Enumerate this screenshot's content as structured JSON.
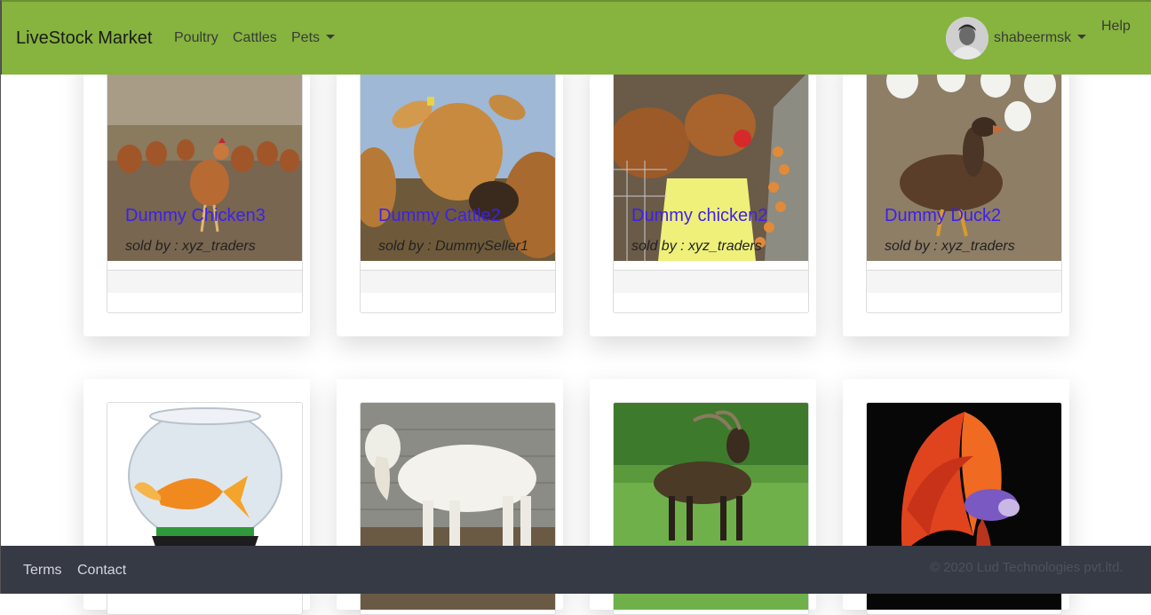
{
  "navbar": {
    "brand": "LiveStock Market",
    "links": [
      "Poultry",
      "Cattles",
      "Pets"
    ],
    "username": "shabeermsk",
    "help": "Help",
    "accent_color": "#86b43e"
  },
  "listings": [
    {
      "title": "Dummy Chicken3",
      "seller": "sold by : xyz_traders",
      "image": "chickens-in-yard"
    },
    {
      "title": "Dummy Cattle2",
      "seller": "sold by : DummySeller1",
      "image": "brown-cow"
    },
    {
      "title": "Dummy chicken2",
      "seller": "sold by : xyz_traders",
      "image": "hens-with-eggs"
    },
    {
      "title": "Dummy Duck2",
      "seller": "sold by : xyz_traders",
      "image": "brown-duck"
    },
    {
      "image": "goldfish-bowl"
    },
    {
      "image": "white-goat"
    },
    {
      "image": "black-goat"
    },
    {
      "image": "betta-fish"
    }
  ],
  "footer": {
    "links": [
      "Terms",
      "Contact"
    ],
    "copyright": "© 2020 Lud Technologies pvt.ltd.",
    "background_color": "#353a45"
  }
}
